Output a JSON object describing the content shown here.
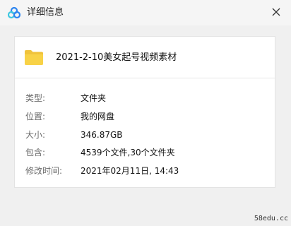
{
  "window": {
    "title": "详细信息",
    "app_icon": "baidu-netdisk-logo-icon",
    "close_icon": "close-icon"
  },
  "file": {
    "icon": "folder-icon",
    "name": "2021-2-10美女起号视频素材"
  },
  "details": [
    {
      "label": "类型:",
      "value": "文件夹"
    },
    {
      "label": "位置:",
      "value": "我的网盘"
    },
    {
      "label": "大小:",
      "value": "346.87GB"
    },
    {
      "label": "包含:",
      "value": "4539个文件,30个文件夹"
    },
    {
      "label": "修改时间:",
      "value": "2021年02月11日, 14:43"
    }
  ],
  "watermark": "58edu.cc",
  "colors": {
    "folder_yellow": "#f8d247",
    "logo_blue": "#2e86f0",
    "logo_teal": "#3ec7e0"
  }
}
